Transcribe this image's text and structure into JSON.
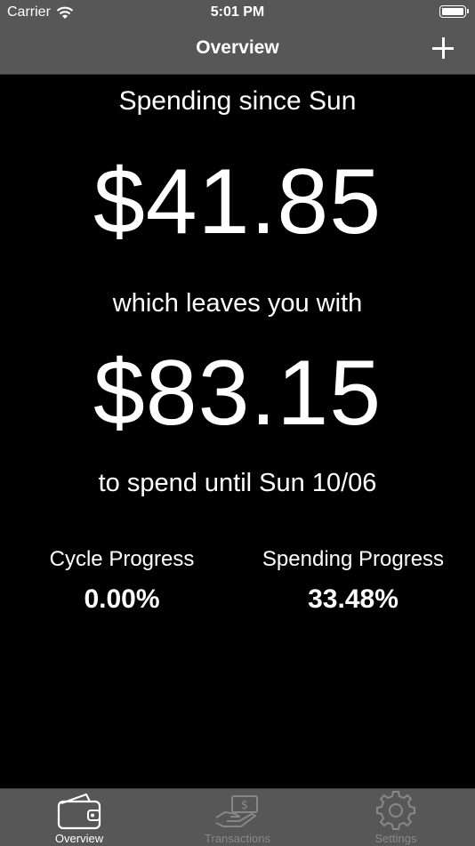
{
  "status_bar": {
    "carrier": "Carrier",
    "time": "5:01 PM"
  },
  "nav": {
    "title": "Overview",
    "add_icon": "plus-icon"
  },
  "overview": {
    "heading": "Spending since Sun",
    "spent_amount": "$41.85",
    "remaining_prefix": "which leaves you with",
    "remaining_amount": "$83.15",
    "until_text": "to spend until Sun 10/06",
    "cycle_progress": {
      "label": "Cycle Progress",
      "value": "0.00%"
    },
    "spending_progress": {
      "label": "Spending Progress",
      "value": "33.48%"
    }
  },
  "tabs": [
    {
      "label": "Overview",
      "icon": "wallet-icon",
      "active": true
    },
    {
      "label": "Transactions",
      "icon": "money-hand-icon",
      "active": false
    },
    {
      "label": "Settings",
      "icon": "gear-icon",
      "active": false
    }
  ],
  "colors": {
    "background": "#000000",
    "bar": "#575757",
    "text": "#ffffff",
    "inactive_tab": "#888888"
  }
}
